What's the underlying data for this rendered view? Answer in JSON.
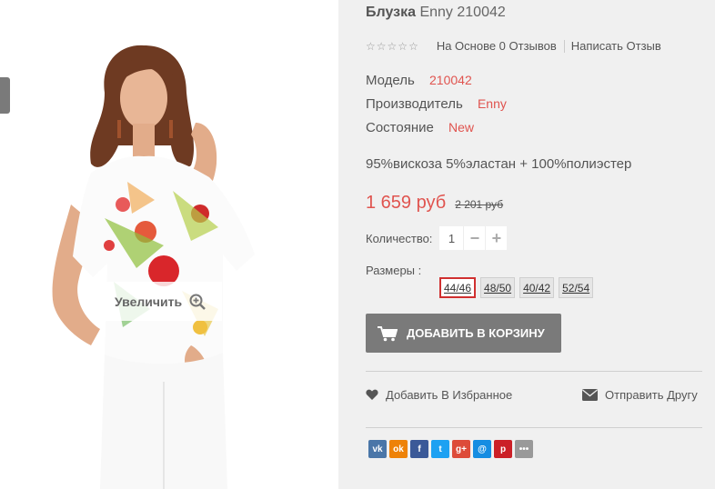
{
  "product": {
    "title_main": "Блузка",
    "title_sub": "Enny 210042",
    "rating": {
      "stars": 0,
      "reviews_label": "На Основе 0 Отзывов",
      "write_review_label": "Написать Отзыв"
    },
    "specs": {
      "model_label": "Модель",
      "model_value": "210042",
      "manufacturer_label": "Производитель",
      "manufacturer_value": "Enny",
      "condition_label": "Состояние",
      "condition_value": "New"
    },
    "composition": "95%вискоза 5%эластан + 100%полиэстер",
    "price_new": "1 659 руб",
    "price_old": "2 201 руб",
    "quantity_label": "Количество:",
    "quantity_value": "1",
    "sizes_label": "Размеры :",
    "sizes": [
      "44/46",
      "48/50",
      "40/42",
      "52/54"
    ],
    "selected_size": "44/46",
    "add_to_cart_label": "ДОБАВИТЬ В КОРЗИНУ",
    "wishlist_label": "Добавить В Избранное",
    "send_friend_label": "Отправить Другу"
  },
  "image": {
    "zoom_label": "Увеличить"
  },
  "social": [
    {
      "name": "vk-icon",
      "glyph": "vk",
      "color": "#4a76a8"
    },
    {
      "name": "odnoklassniki-icon",
      "glyph": "ok",
      "color": "#ee8208"
    },
    {
      "name": "facebook-icon",
      "glyph": "f",
      "color": "#3b5998"
    },
    {
      "name": "twitter-icon",
      "glyph": "t",
      "color": "#1da1f2"
    },
    {
      "name": "googleplus-icon",
      "glyph": "g+",
      "color": "#dd4b39"
    },
    {
      "name": "mail-icon",
      "glyph": "@",
      "color": "#168de2"
    },
    {
      "name": "pinterest-icon",
      "glyph": "p",
      "color": "#cb2027"
    },
    {
      "name": "more-icon",
      "glyph": "•••",
      "color": "#999999"
    }
  ],
  "colors": {
    "accent": "#e0544f",
    "button": "#7a7a7a"
  }
}
